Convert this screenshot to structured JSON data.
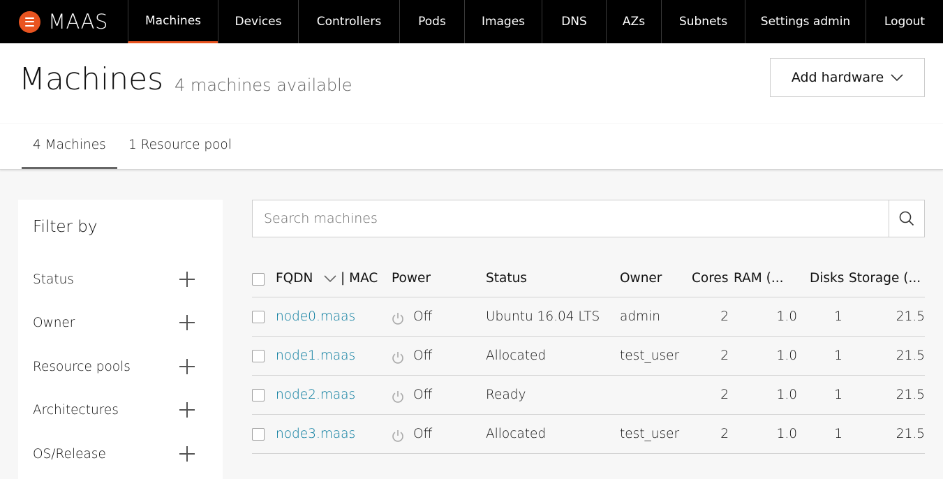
{
  "brand": {
    "name": "MAAS"
  },
  "nav": {
    "items": [
      {
        "label": "Machines"
      },
      {
        "label": "Devices"
      },
      {
        "label": "Controllers"
      },
      {
        "label": "Pods"
      },
      {
        "label": "Images"
      },
      {
        "label": "DNS"
      },
      {
        "label": "AZs"
      },
      {
        "label": "Subnets"
      },
      {
        "label": "Settings admin"
      },
      {
        "label": "Logout"
      }
    ],
    "active": "Machines"
  },
  "header": {
    "title": "Machines",
    "subtitle": "4 machines available",
    "add_hardware_label": "Add hardware"
  },
  "tabs": [
    {
      "label": "4 Machines"
    },
    {
      "label": "1 Resource pool"
    }
  ],
  "filter": {
    "title": "Filter by",
    "items": [
      {
        "label": "Status"
      },
      {
        "label": "Owner"
      },
      {
        "label": "Resource pools"
      },
      {
        "label": "Architectures"
      },
      {
        "label": "OS/Release"
      }
    ]
  },
  "search": {
    "placeholder": "Search machines"
  },
  "table": {
    "columns": {
      "fqdn": "FQDN",
      "mac": "| MAC",
      "power": "Power",
      "status": "Status",
      "owner": "Owner",
      "cores": "Cores",
      "ram": "RAM (...",
      "disks": "Disks",
      "storage": "Storage (..."
    },
    "rows": [
      {
        "fqdn": "node0.maas",
        "power": "Off",
        "status": "Ubuntu 16.04 LTS",
        "owner": "admin",
        "cores": "2",
        "ram": "1.0",
        "disks": "1",
        "storage": "21.5"
      },
      {
        "fqdn": "node1.maas",
        "power": "Off",
        "status": "Allocated",
        "owner": "test_user",
        "cores": "2",
        "ram": "1.0",
        "disks": "1",
        "storage": "21.5"
      },
      {
        "fqdn": "node2.maas",
        "power": "Off",
        "status": "Ready",
        "owner": "",
        "cores": "2",
        "ram": "1.0",
        "disks": "1",
        "storage": "21.5"
      },
      {
        "fqdn": "node3.maas",
        "power": "Off",
        "status": "Allocated",
        "owner": "test_user",
        "cores": "2",
        "ram": "1.0",
        "disks": "1",
        "storage": "21.5"
      }
    ]
  },
  "colors": {
    "accent": "#e95420",
    "link": "#00779b",
    "nav_bg": "#000000"
  }
}
